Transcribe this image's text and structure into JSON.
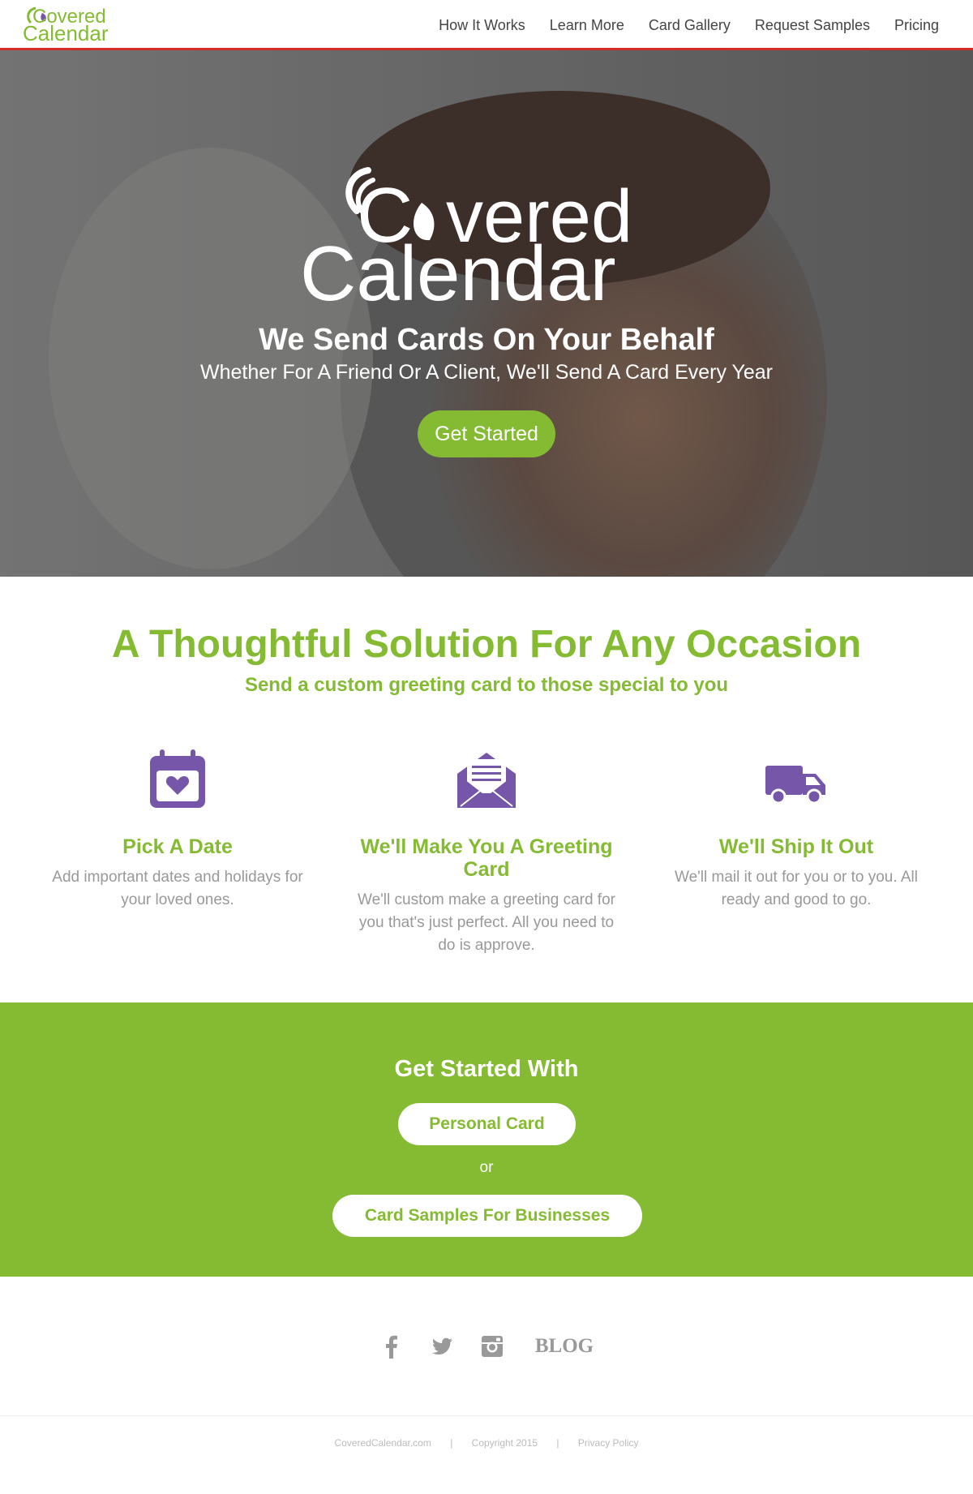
{
  "brand": {
    "name_line1": "Covered",
    "name_line2": "Calendar",
    "accent_color": "#84bb33",
    "icon_color": "#7556a8"
  },
  "nav": {
    "items": [
      {
        "label": "How It Works"
      },
      {
        "label": "Learn More"
      },
      {
        "label": "Card Gallery"
      },
      {
        "label": "Request Samples"
      },
      {
        "label": "Pricing"
      }
    ]
  },
  "hero": {
    "title": "We Send Cards On Your Behalf",
    "subtitle": "Whether For A Friend Or A Client, We'll Send A Card Every Year",
    "cta_label": "Get Started"
  },
  "features_section": {
    "title": "A Thoughtful Solution For Any Occasion",
    "subtitle": "Send a custom greeting card to those special to you",
    "items": [
      {
        "icon": "calendar-heart-icon",
        "title": "Pick A Date",
        "text": "Add important dates and holidays for your loved ones."
      },
      {
        "icon": "envelope-letter-icon",
        "title": "We'll Make You A Greeting Card",
        "text": "We'll custom make a greeting card for you that's just perfect. All you need to do is approve."
      },
      {
        "icon": "delivery-truck-icon",
        "title": "We'll Ship It Out",
        "text": "We'll mail it out for you or to you. All ready and good to go."
      }
    ]
  },
  "cta": {
    "title": "Get Started With",
    "personal_label": "Personal Card",
    "or_text": "or",
    "business_label": "Card Samples For Businesses"
  },
  "social": {
    "icons": [
      "facebook-icon",
      "twitter-icon",
      "instagram-icon"
    ],
    "blog_label": "BLOG"
  },
  "footer": {
    "site": "CoveredCalendar.com",
    "sep": "|",
    "copyright": "Copyright 2015",
    "privacy": "Privacy Policy"
  }
}
